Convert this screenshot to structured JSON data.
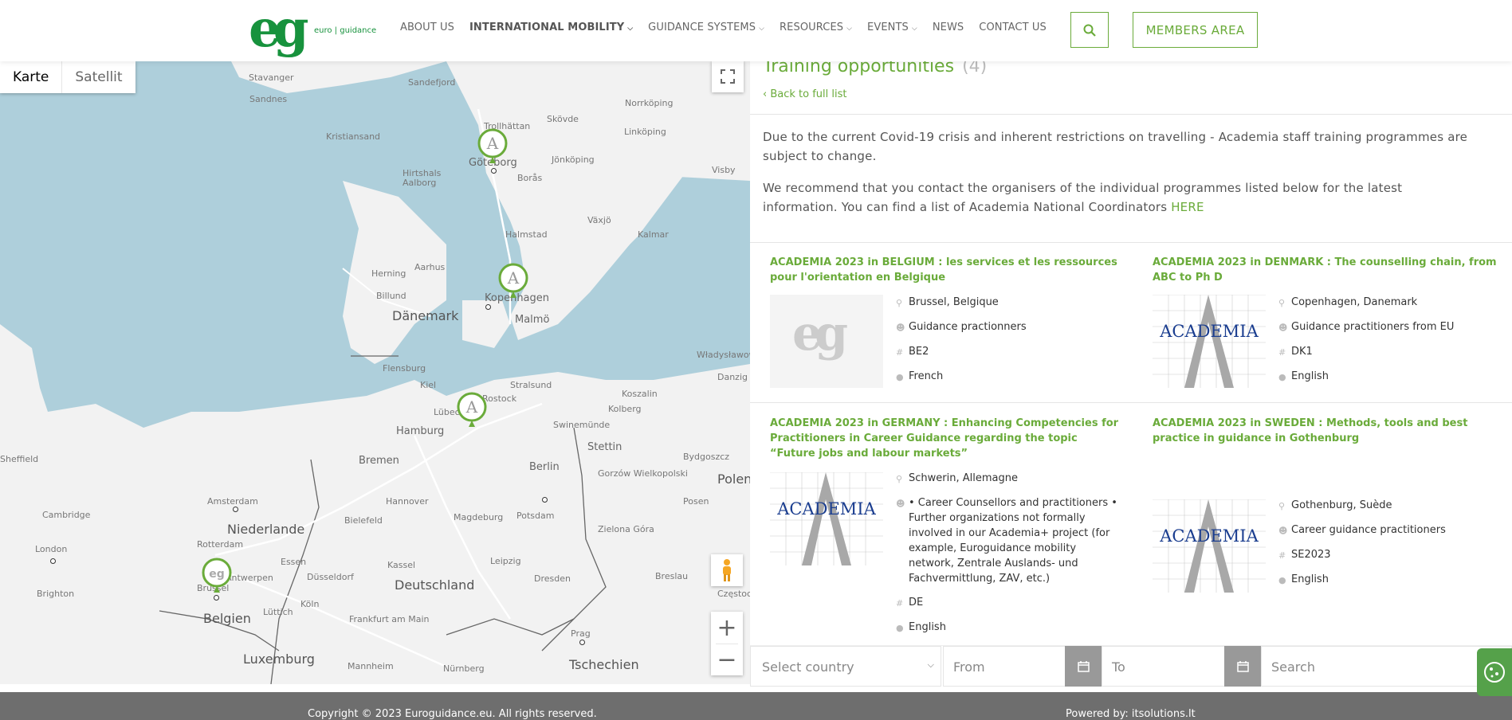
{
  "header": {
    "logo_mark": "eg",
    "logo_text": "euro | guidance",
    "nav": [
      {
        "label": "ABOUT US",
        "caret": false,
        "active": false
      },
      {
        "label": "INTERNATIONAL MOBILITY",
        "caret": true,
        "active": true
      },
      {
        "label": "GUIDANCE SYSTEMS",
        "caret": true,
        "active": false
      },
      {
        "label": "RESOURCES",
        "caret": true,
        "active": false
      },
      {
        "label": "EVENTS",
        "caret": true,
        "active": false
      },
      {
        "label": "NEWS",
        "caret": false,
        "active": false
      },
      {
        "label": "CONTACT US",
        "caret": false,
        "active": false
      }
    ],
    "members_label": "MEMBERS AREA",
    "accent_color": "#6aab3a",
    "logo_color": "#17923d"
  },
  "map": {
    "type_map_label": "Karte",
    "type_satellite_label": "Satellit",
    "water_color": "#aecfdb",
    "land_color": "#f2f2f2",
    "countries": [
      "Dänemark",
      "Niederlande",
      "Belgien",
      "Deutschland",
      "Luxemburg",
      "Tschechien",
      "Polen"
    ],
    "cities": [
      "Stavanger",
      "Sandefjord",
      "Sandnes",
      "Kristiansand",
      "Trollhättan",
      "Göteborg",
      "Skövde",
      "Norrköping",
      "Linköping",
      "Jönköping",
      "Visby",
      "Borås",
      "Hirtshals",
      "Aalborg",
      "Växjö",
      "Halmstad",
      "Kalmar",
      "Herning",
      "Aarhus",
      "Billund",
      "Kopenhagen",
      "Malmö",
      "Flensburg",
      "Kiel",
      "Stralsund",
      "Rostock",
      "Lübeck",
      "Koszalin",
      "Władysławowo",
      "Danzig",
      "Kolberg",
      "Hamburg",
      "Swinemünde",
      "Stettin",
      "Bremen",
      "Berlin",
      "Gorzów Wielkopolski",
      "Bydgoszcz",
      "Amsterdam",
      "Hannover",
      "Bielefeld",
      "Magdeburg",
      "Potsdam",
      "Posen",
      "Zielona Góra",
      "Rotterdam",
      "Essen",
      "Düsseldorf",
      "Kassel",
      "Leipzig",
      "Dresden",
      "Breslau",
      "Antwerpen",
      "Brussel",
      "Köln",
      "Lüttich",
      "Frankfurt am Main",
      "Prag",
      "Mannheim",
      "Nürnberg",
      "London",
      "Cambridge",
      "Brighton",
      "Sheffield",
      "Częstochowa"
    ]
  },
  "list": {
    "title": "Training opportunities",
    "count": "(4)",
    "back_label": "Back to full list",
    "notice_1": "Due to the current Covid-19 crisis and inherent restrictions on travelling - Academia staff training programmes are subject to change.",
    "notice_2": "We recommend that you contact the organisers of the individual programmes listed below for the latest information. You can find a list of Academia National Coordinators",
    "notice_link": "HERE",
    "cards": [
      {
        "title": "ACADEMIA 2023 in BELGIUM : les services et les ressources pour l'orientation en Belgique",
        "image": "eg-logo-placeholder",
        "location": "Brussel, Belgique",
        "audience": "Guidance practionners",
        "code": "BE2",
        "language": "French"
      },
      {
        "title": "ACADEMIA 2023 in DENMARK : The counselling chain, from ABC to Ph D",
        "image": "academia-logo",
        "location": "Copenhagen, Danemark",
        "audience": "Guidance practitioners from EU",
        "code": "DK1",
        "language": "English"
      },
      {
        "title": "ACADEMIA 2023 in GERMANY : Enhancing Competencies for Practitioners in Career Guidance regarding the topic “Future jobs and labour markets”",
        "image": "academia-logo",
        "location": "Schwerin, Allemagne",
        "audience": "• Career Counsellors and practitioners • Further organizations not formally involved in our Academia+ project (for example, Euroguidance mobility network, Zentrale Auslands- und Fachvermittlung, ZAV, etc.)",
        "code": "DE",
        "language": "English"
      },
      {
        "title": "ACADEMIA 2023 in SWEDEN : Methods, tools and best practice in guidance in Gothenburg",
        "image": "academia-logo",
        "location": "Gothenburg, Suède",
        "audience": "Career guidance practitioners",
        "code": "SE2023",
        "language": "English"
      }
    ],
    "academia_logo_text": "ACADEMIA"
  },
  "filter": {
    "country_placeholder": "Select country",
    "from_placeholder": "From",
    "to_placeholder": "To",
    "search_placeholder": "Search"
  },
  "footer": {
    "copyright": "Copyright © 2023 Euroguidance.eu. All rights reserved.",
    "powered": "Powered by: itsolutions.lt"
  }
}
